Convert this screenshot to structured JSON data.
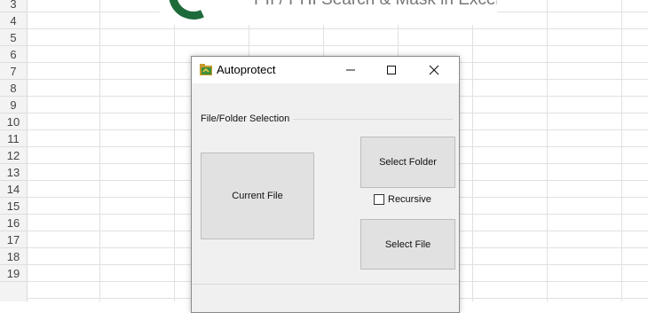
{
  "sheet": {
    "rows": [
      "3",
      "4",
      "5",
      "6",
      "7",
      "8",
      "9",
      "10",
      "11",
      "12",
      "13",
      "14",
      "15",
      "16",
      "17",
      "18",
      "19"
    ]
  },
  "banner": {
    "text": "PII / PHI Search & Mask in Excel",
    "logo_color": "#1e6b3a"
  },
  "dialog": {
    "title": "Autoprotect",
    "icon": "autoprotect-app-icon",
    "controls": {
      "minimize": "minimize-icon",
      "maximize": "maximize-icon",
      "close": "close-icon"
    },
    "group_label": "File/Folder Selection",
    "buttons": {
      "current_file": "Current File",
      "select_folder": "Select Folder",
      "select_file": "Select File"
    },
    "recursive": {
      "label": "Recursive",
      "checked": false
    }
  }
}
